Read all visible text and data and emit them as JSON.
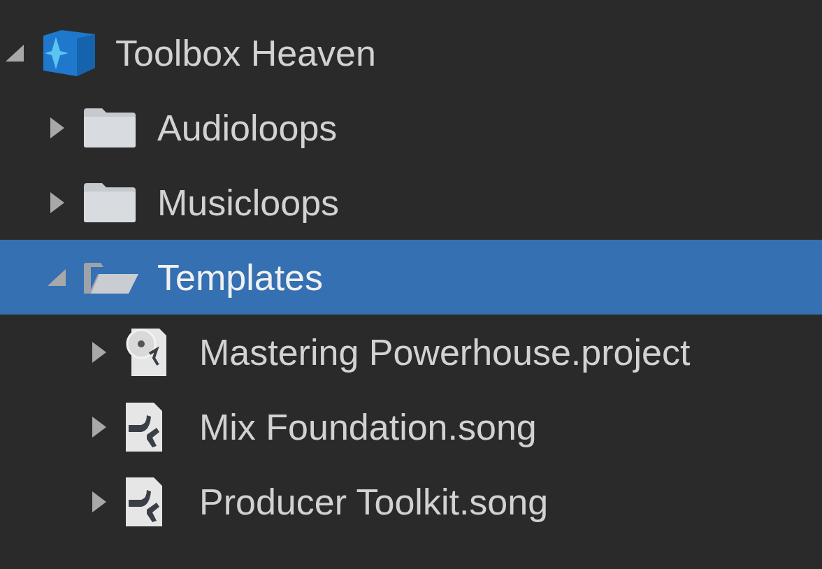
{
  "tree": [
    {
      "label": "Toolbox Heaven",
      "kind": "box",
      "expanded": true,
      "selected": false,
      "children": [
        {
          "label": "Audioloops",
          "kind": "folder",
          "expanded": false,
          "selected": false
        },
        {
          "label": "Musicloops",
          "kind": "folder",
          "expanded": false,
          "selected": false
        },
        {
          "label": "Templates",
          "kind": "folder",
          "expanded": true,
          "selected": true,
          "children": [
            {
              "label": "Mastering Powerhouse.project",
              "kind": "project",
              "expanded": false,
              "selected": false
            },
            {
              "label": "Mix Foundation.song",
              "kind": "song",
              "expanded": false,
              "selected": false
            },
            {
              "label": "Producer Toolkit.song",
              "kind": "song",
              "expanded": false,
              "selected": false
            }
          ]
        }
      ]
    }
  ]
}
